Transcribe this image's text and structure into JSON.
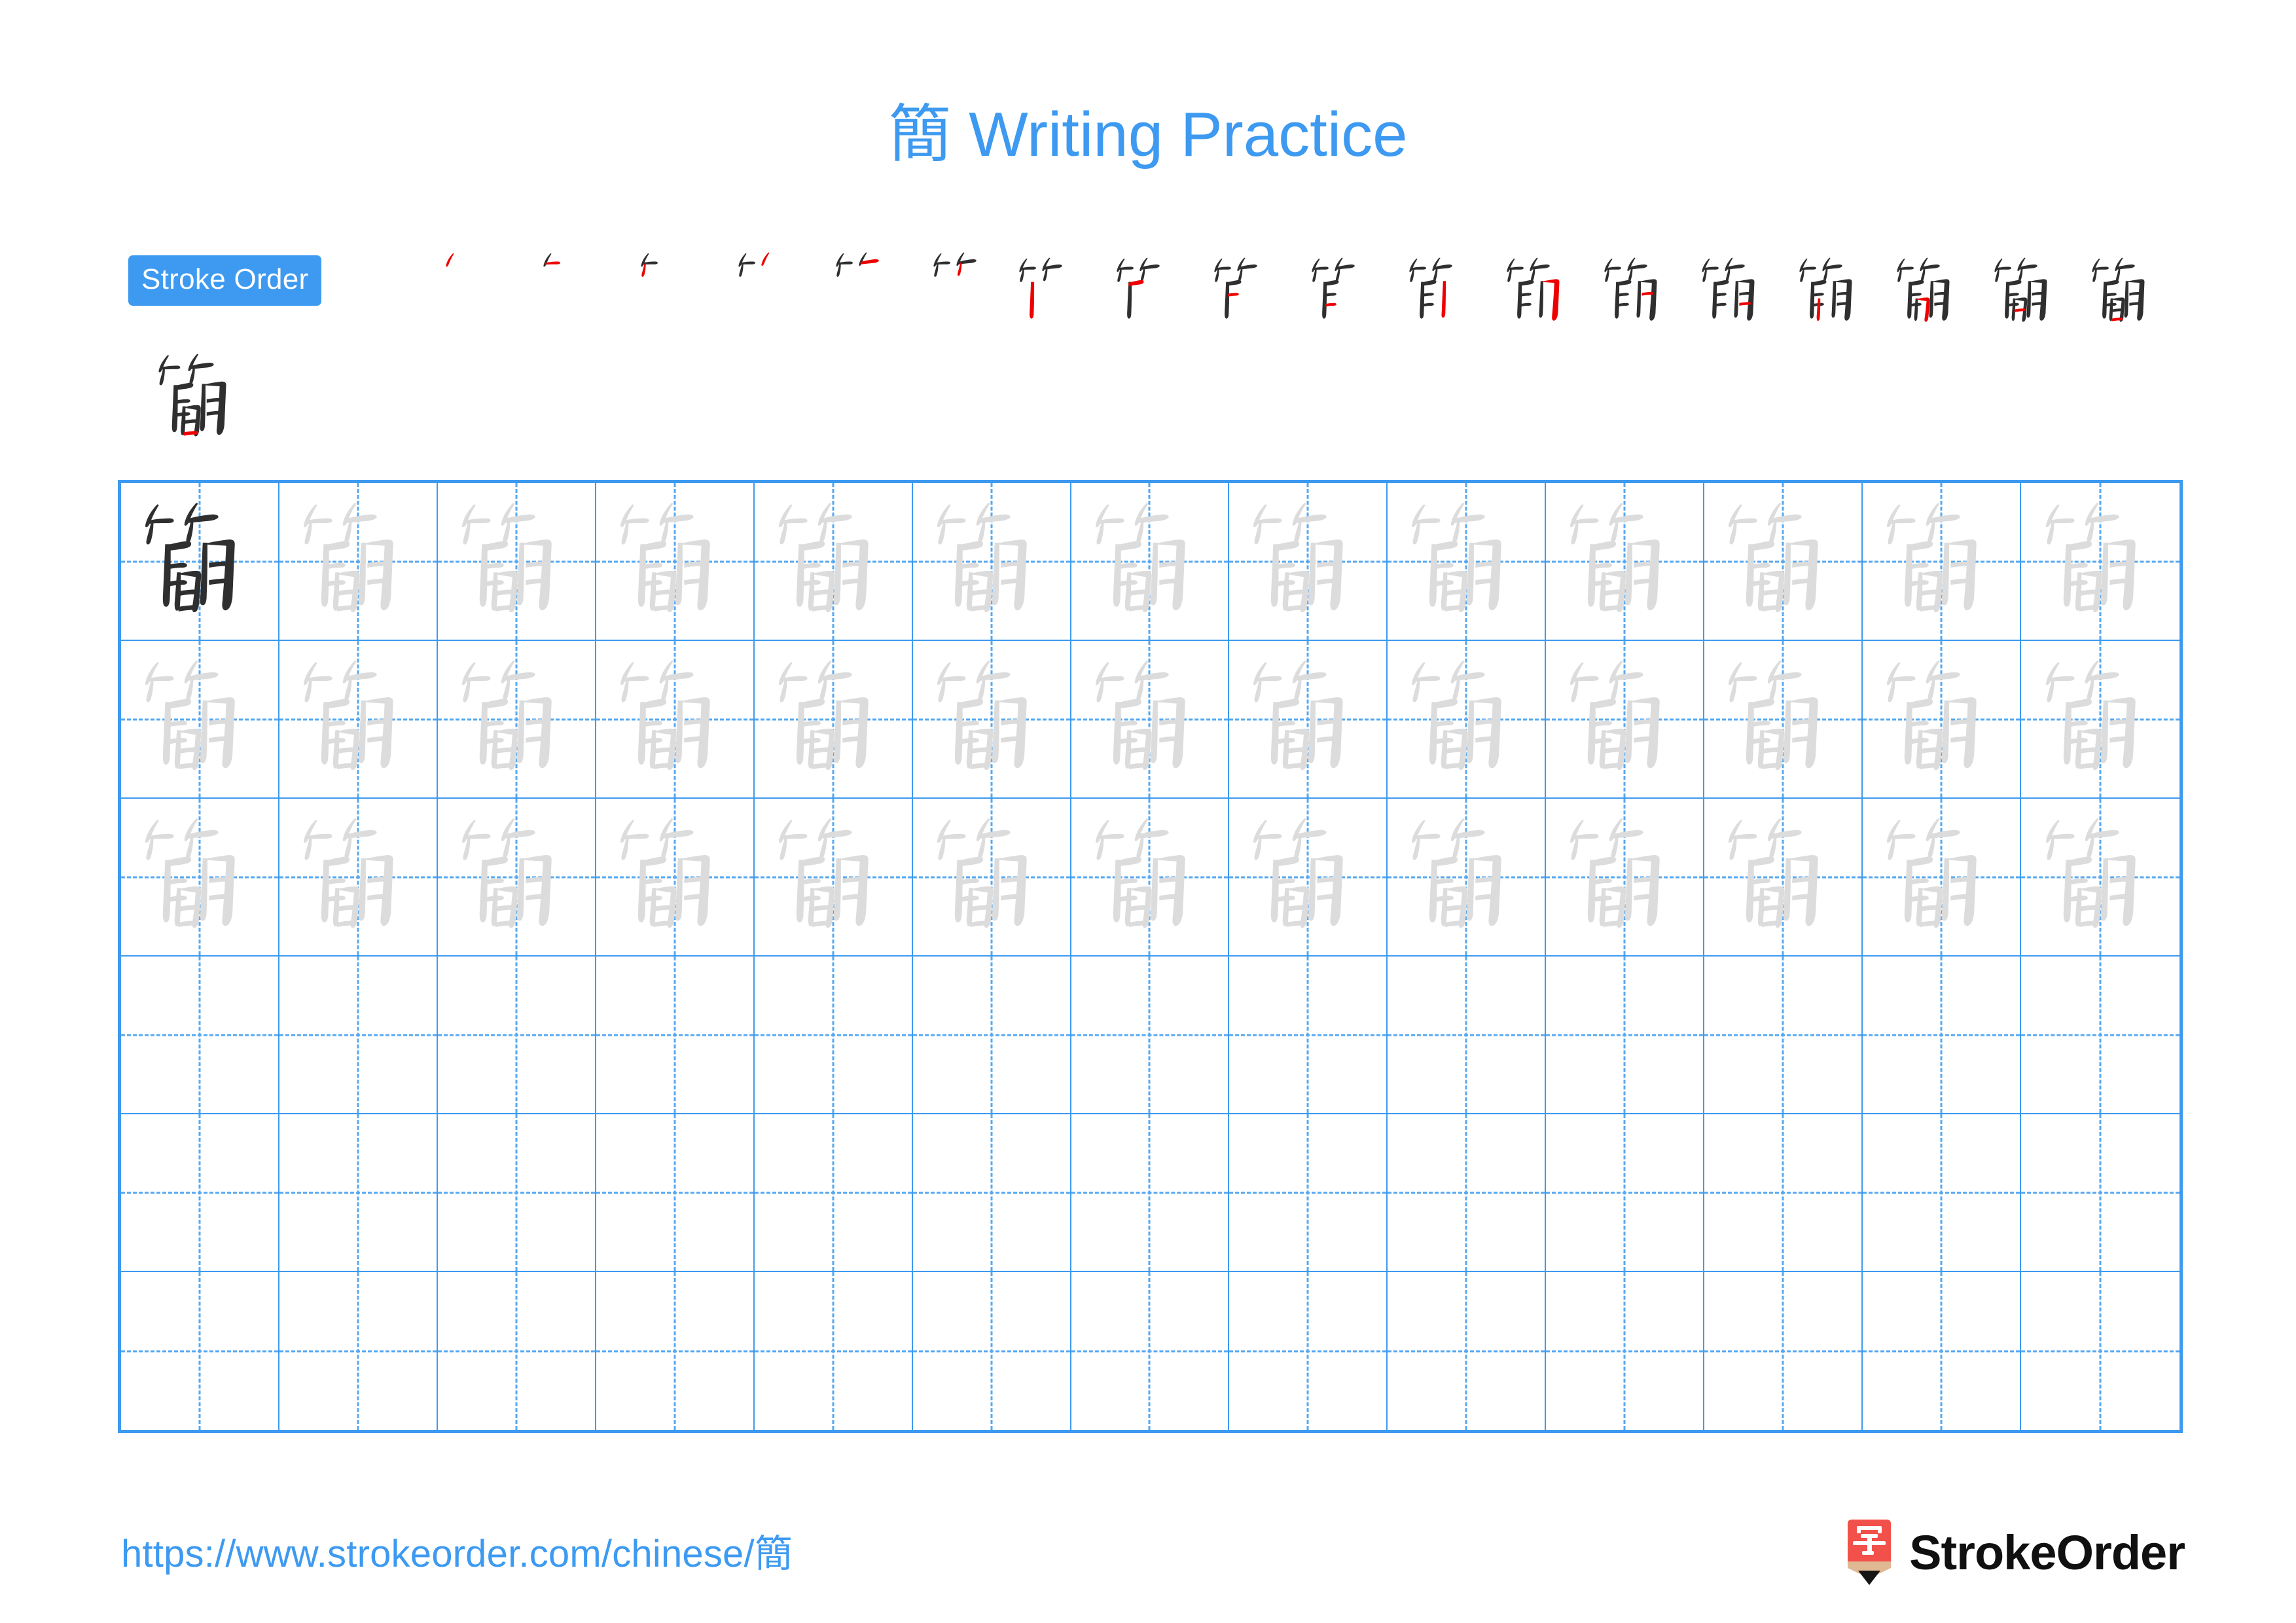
{
  "document": {
    "type": "chinese-character-writing-practice-worksheet",
    "character": "簡",
    "stroke_count": 18
  },
  "title": {
    "character": "簡",
    "text": " Writing Practice",
    "full": "簡 Writing Practice",
    "color": "#3d9af0"
  },
  "stroke_order": {
    "badge_label": "Stroke Order",
    "badge_bg": "#3d9af0",
    "badge_fg": "#ffffff",
    "new_stroke_color": "#ee0000",
    "existing_stroke_color": "#2f2f2f",
    "steps_count": 18,
    "steps": [
      {
        "index": 1,
        "strokes_shown": 1
      },
      {
        "index": 2,
        "strokes_shown": 2
      },
      {
        "index": 3,
        "strokes_shown": 3
      },
      {
        "index": 4,
        "strokes_shown": 4
      },
      {
        "index": 5,
        "strokes_shown": 5
      },
      {
        "index": 6,
        "strokes_shown": 6
      },
      {
        "index": 7,
        "strokes_shown": 7
      },
      {
        "index": 8,
        "strokes_shown": 8
      },
      {
        "index": 9,
        "strokes_shown": 9
      },
      {
        "index": 10,
        "strokes_shown": 10
      },
      {
        "index": 11,
        "strokes_shown": 11
      },
      {
        "index": 12,
        "strokes_shown": 12
      },
      {
        "index": 13,
        "strokes_shown": 13
      },
      {
        "index": 14,
        "strokes_shown": 14
      },
      {
        "index": 15,
        "strokes_shown": 15
      },
      {
        "index": 16,
        "strokes_shown": 16
      },
      {
        "index": 17,
        "strokes_shown": 17
      },
      {
        "index": 18,
        "strokes_shown": 18
      }
    ]
  },
  "sample": {
    "character": "簡",
    "body_color": "#2f2f2f",
    "highlight_color": "#ee0000"
  },
  "practice_grid": {
    "columns": 13,
    "rows": 6,
    "grid_line_color": "#3d9af0",
    "guide_line_color": "#56a8f2",
    "model_char_color": "#2f2f2f",
    "trace_char_color": "#dcdcdc",
    "character": "簡",
    "row_fill": [
      {
        "row": 1,
        "model_cells": 1,
        "trace_cells": 12,
        "empty_cells": 0
      },
      {
        "row": 2,
        "model_cells": 0,
        "trace_cells": 13,
        "empty_cells": 0
      },
      {
        "row": 3,
        "model_cells": 0,
        "trace_cells": 13,
        "empty_cells": 0
      },
      {
        "row": 4,
        "model_cells": 0,
        "trace_cells": 0,
        "empty_cells": 13
      },
      {
        "row": 5,
        "model_cells": 0,
        "trace_cells": 0,
        "empty_cells": 13
      },
      {
        "row": 6,
        "model_cells": 0,
        "trace_cells": 0,
        "empty_cells": 13
      }
    ]
  },
  "footer": {
    "url": "https://www.strokeorder.com/chinese/簡",
    "url_color": "#3d9af0",
    "brand_name": "StrokeOrder",
    "logo_glyph": "字",
    "logo_body_color": "#f2504b",
    "logo_tip_color": "#e0b894",
    "logo_point_color": "#151515"
  }
}
